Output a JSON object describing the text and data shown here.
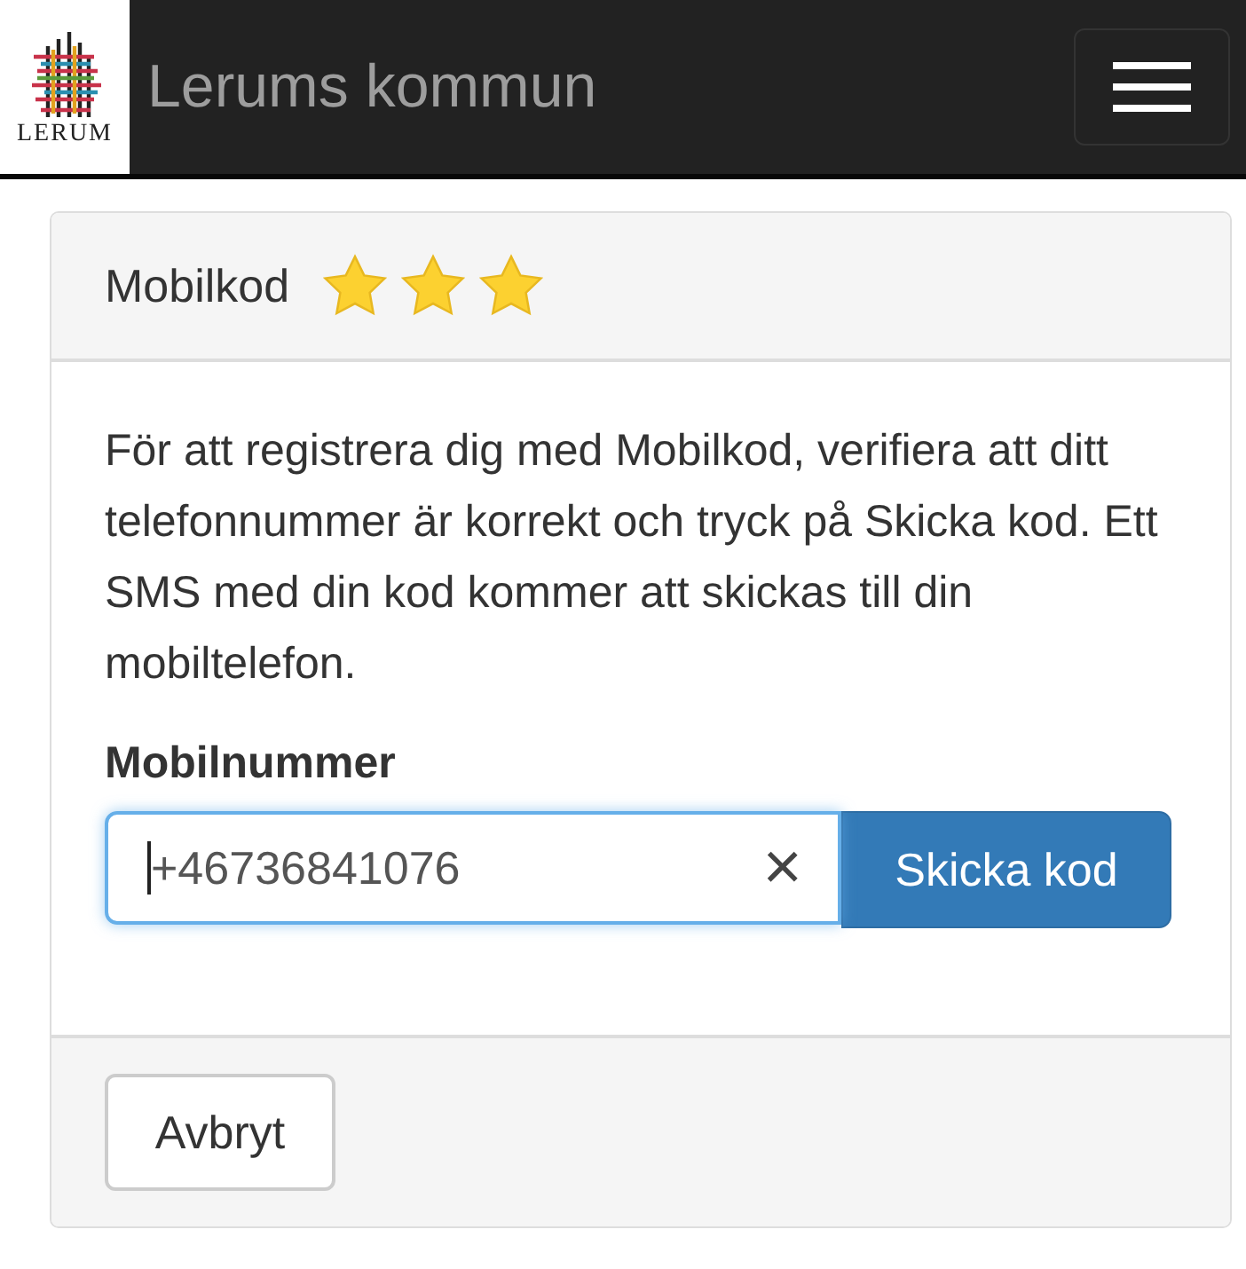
{
  "navbar": {
    "logo_text": "LERUM",
    "brand": "Lerums kommun"
  },
  "panel": {
    "title": "Mobilkod",
    "stars": 3,
    "intro": "För att registrera dig med Mobilkod, verifiera att ditt telefonnummer är korrekt och tryck på Skicka kod. Ett SMS med din kod kommer att skickas till din mobiltelefon.",
    "field_label": "Mobilnummer",
    "phone": "+46736841076",
    "clear": "×",
    "submit": "Skicka kod",
    "cancel": "Avbryt"
  }
}
